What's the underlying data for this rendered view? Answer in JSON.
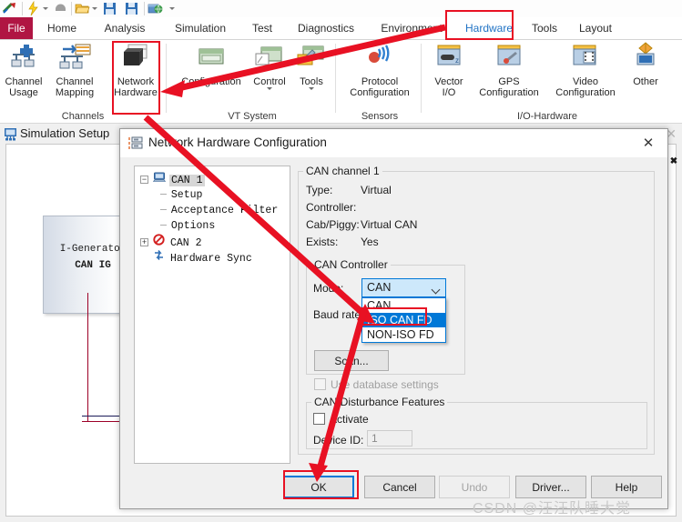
{
  "quick_access": {
    "icons": [
      "vector-logo-icon",
      "lightning-icon",
      "dropdown-caret-icon",
      "stop-icon",
      "open-folder-icon",
      "dropdown-caret-icon",
      "save-icon",
      "save-as-icon",
      "globe-window-icon",
      "overflow-caret-icon"
    ]
  },
  "ribbon": {
    "tabs": [
      {
        "label": "File",
        "active": false,
        "file": true
      },
      {
        "label": "Home",
        "active": false
      },
      {
        "label": "Analysis",
        "active": false
      },
      {
        "label": "Simulation",
        "active": false
      },
      {
        "label": "Test",
        "active": false
      },
      {
        "label": "Diagnostics",
        "active": false
      },
      {
        "label": "Environment",
        "active": false
      },
      {
        "label": "Hardware",
        "active": true
      },
      {
        "label": "Tools",
        "active": false
      },
      {
        "label": "Layout",
        "active": false
      }
    ],
    "groups": [
      {
        "name": "Channels"
      },
      {
        "name": "VT System"
      },
      {
        "name": "Sensors"
      },
      {
        "name": "I/O-Hardware"
      }
    ],
    "buttons": [
      {
        "label": "Channel\nUsage",
        "icon": "channel-usage-icon"
      },
      {
        "label": "Channel\nMapping",
        "icon": "channel-mapping-icon"
      },
      {
        "label": "Network\nHardware",
        "icon": "network-hardware-icon"
      },
      {
        "label": "Configuration",
        "icon": "vt-configuration-icon"
      },
      {
        "label": "Control",
        "icon": "vt-control-icon"
      },
      {
        "label": "Tools",
        "icon": "vt-tools-icon"
      },
      {
        "label": "Protocol\nConfiguration",
        "icon": "protocol-configuration-icon"
      },
      {
        "label": "Vector\nI/O",
        "icon": "vector-io-icon"
      },
      {
        "label": "GPS\nConfiguration",
        "icon": "gps-configuration-icon"
      },
      {
        "label": "Video\nConfiguration",
        "icon": "video-configuration-icon"
      },
      {
        "label": "Other",
        "icon": "other-icon"
      }
    ]
  },
  "sim_window": {
    "title": "Simulation Setup",
    "icon": "simulation-setup-icon",
    "node": {
      "role": "I-Generator",
      "name": "CAN IG"
    }
  },
  "dialog": {
    "title": "Network Hardware Configuration",
    "icon": "network-hardware-dialog-icon",
    "close_label": "✕",
    "tree": [
      {
        "label": "CAN 1",
        "icon": "computer-icon",
        "depth": 0,
        "expander": "−",
        "selected": true
      },
      {
        "label": "Setup",
        "icon": "none",
        "depth": 1,
        "expander": "",
        "selected": false
      },
      {
        "label": "Acceptance Filter",
        "icon": "none",
        "depth": 1,
        "expander": "",
        "selected": false
      },
      {
        "label": "Options",
        "icon": "none",
        "depth": 1,
        "expander": "",
        "selected": false
      },
      {
        "label": "CAN 2",
        "icon": "disabled-icon",
        "depth": 0,
        "expander": "+",
        "selected": false
      },
      {
        "label": "Hardware Sync",
        "icon": "sync-icon",
        "depth": 0,
        "expander": "",
        "selected": false
      }
    ],
    "channel_group": {
      "legend": "CAN channel 1",
      "fields": [
        {
          "label": "Type:",
          "value": "Virtual"
        },
        {
          "label": "Controller:",
          "value": ""
        },
        {
          "label": "Cab/Piggy:",
          "value": "Virtual CAN"
        },
        {
          "label": "Exists:",
          "value": "Yes"
        }
      ]
    },
    "controller_group": {
      "legend": "CAN Controller",
      "mode_label": "Mode:",
      "mode_value": "CAN",
      "baudrate_label": "Baud rate:",
      "options": [
        {
          "label": "CAN",
          "selected": false
        },
        {
          "label": "ISO CAN FD",
          "selected": true
        },
        {
          "label": "NON-ISO FD",
          "selected": false
        }
      ],
      "scan_label": "Scan...",
      "use_db_label": "Use database settings",
      "use_db_disabled": true
    },
    "disturbance_group": {
      "legend": "CAN Disturbance Features",
      "activate_label": "Activate",
      "device_id_label": "Device ID:",
      "device_id_value": "1"
    },
    "footer_buttons": [
      {
        "label": "OK",
        "state": "focus"
      },
      {
        "label": "Cancel",
        "state": "normal"
      },
      {
        "label": "Undo",
        "state": "disabled"
      },
      {
        "label": "Driver...",
        "state": "normal"
      },
      {
        "label": "Help",
        "state": "normal"
      }
    ]
  },
  "watermark": {
    "text": "CSDN @汪汪队睡大觉"
  },
  "annotation": {
    "color": "#e81123",
    "focus_color": "#0078d7",
    "accent_color": "#1f72c4"
  }
}
